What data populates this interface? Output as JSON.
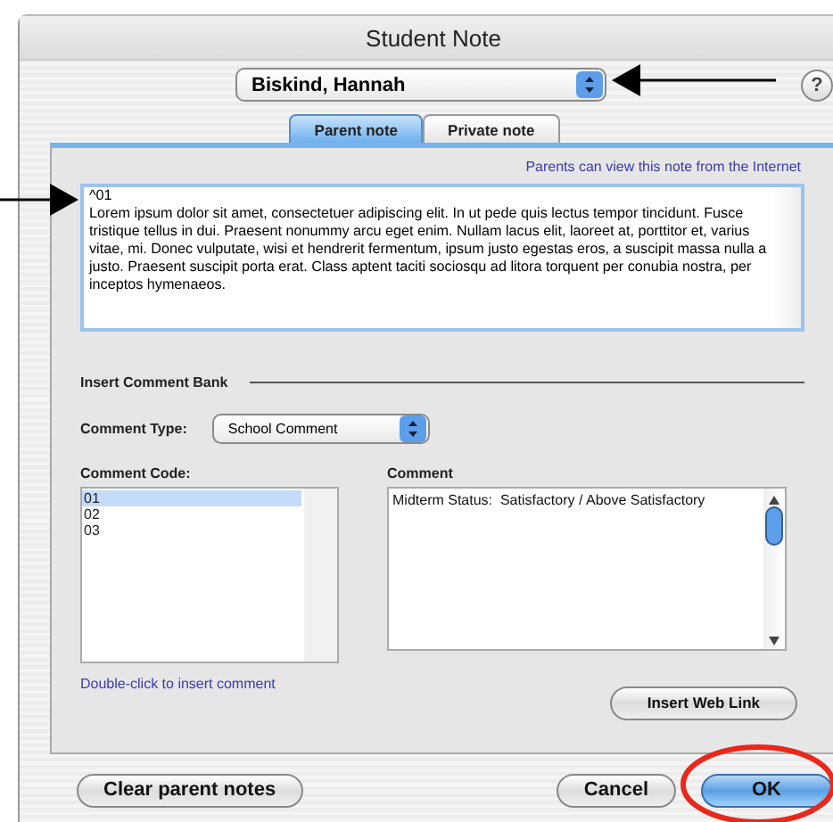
{
  "window": {
    "title": "Student Note"
  },
  "student_popup": {
    "value": "Biskind, Hannah"
  },
  "help_button": {
    "label": "?"
  },
  "tabs": [
    {
      "label": "Parent note",
      "selected": true
    },
    {
      "label": "Private note",
      "selected": false
    }
  ],
  "internet_notice": "Parents can view this note from the Internet",
  "note": {
    "value": "^01\nLorem ipsum dolor sit amet, consectetuer adipiscing elit. In ut pede quis lectus tempor tincidunt. Fusce tristique tellus in dui. Praesent nonummy arcu eget enim. Nullam lacus elit, laoreet at, porttitor et, varius vitae, mi. Donec vulputate, wisi et hendrerit fermentum, ipsum justo egestas eros, a suscipit massa nulla a justo. Praesent suscipit porta erat. Class aptent taciti sociosqu ad litora torquent per conubia nostra, per inceptos hymenaeos."
  },
  "comment_bank": {
    "heading": "Insert Comment Bank",
    "type_label": "Comment Type:",
    "type_value": "School Comment",
    "code_label": "Comment Code:",
    "codes": [
      {
        "label": "01",
        "selected": true
      },
      {
        "label": "02",
        "selected": false
      },
      {
        "label": "03",
        "selected": false
      }
    ],
    "comment_label": "Comment",
    "comment_text": "Midterm Status:  Satisfactory / Above Satisfactory",
    "hint": "Double-click to insert comment",
    "web_link_button": "Insert Web Link"
  },
  "footer_buttons": [
    {
      "label": "Clear parent notes",
      "default": false
    },
    {
      "label": "Cancel",
      "default": false
    },
    {
      "label": "OK",
      "default": true
    }
  ]
}
